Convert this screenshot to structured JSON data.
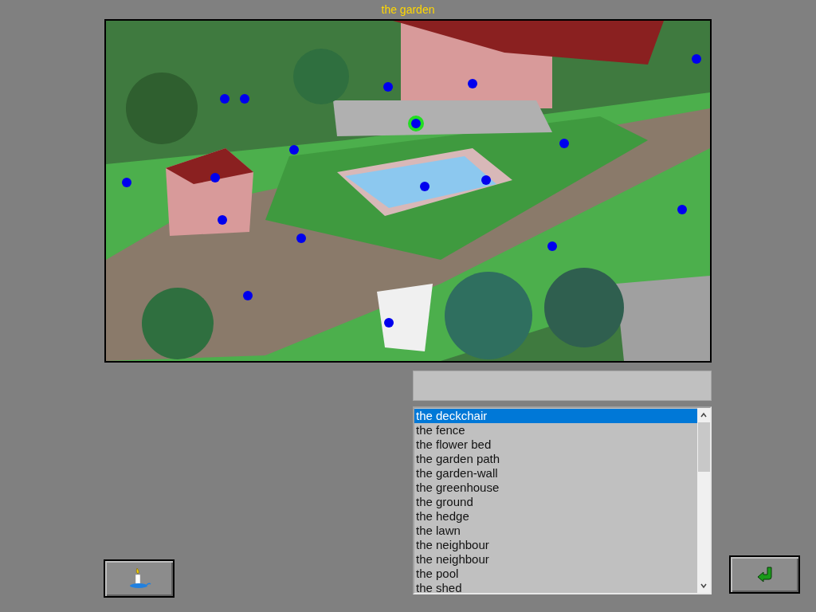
{
  "title": "the garden",
  "hotspots": [
    {
      "selected": false
    },
    {
      "selected": false
    },
    {
      "selected": false
    },
    {
      "selected": false
    },
    {
      "selected": false
    },
    {
      "selected": true
    },
    {
      "selected": false
    },
    {
      "selected": false
    },
    {
      "selected": false
    },
    {
      "selected": false
    },
    {
      "selected": false
    },
    {
      "selected": false
    },
    {
      "selected": false
    },
    {
      "selected": false
    },
    {
      "selected": false
    },
    {
      "selected": false
    },
    {
      "selected": false
    },
    {
      "selected": false
    }
  ],
  "words": [
    {
      "label": "the deckchair",
      "selected": true
    },
    {
      "label": "the fence",
      "selected": false
    },
    {
      "label": "the flower bed",
      "selected": false
    },
    {
      "label": "the garden path",
      "selected": false
    },
    {
      "label": "the garden-wall",
      "selected": false
    },
    {
      "label": "the greenhouse",
      "selected": false
    },
    {
      "label": "the ground",
      "selected": false
    },
    {
      "label": "the hedge",
      "selected": false
    },
    {
      "label": "the lawn",
      "selected": false
    },
    {
      "label": "the neighbour",
      "selected": false
    },
    {
      "label": "the neighbour",
      "selected": false
    },
    {
      "label": "the pool",
      "selected": false
    },
    {
      "label": "the shed",
      "selected": false
    }
  ]
}
